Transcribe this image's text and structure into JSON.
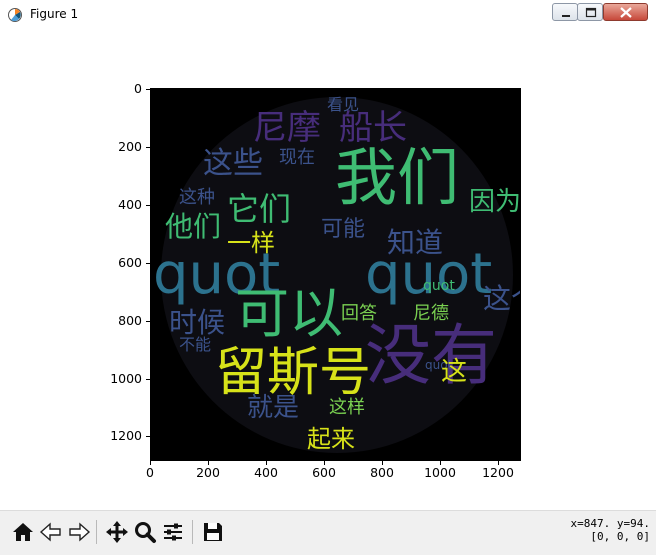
{
  "window": {
    "title": "Figure 1",
    "icon": "matplotlib-icon"
  },
  "colors": {
    "plot_bg": "#000000",
    "yellow": "#d7e219",
    "green": "#3fbc73",
    "teal": "#2c728e",
    "blue": "#3b528b",
    "purple": "#472d7b",
    "lime": "#7ad151"
  },
  "axes": {
    "x_ticks": [
      "0",
      "200",
      "400",
      "600",
      "800",
      "1000",
      "1200"
    ],
    "y_ticks": [
      "0",
      "200",
      "400",
      "600",
      "800",
      "1000",
      "1200"
    ],
    "xlim": [
      0,
      1280
    ],
    "ylim": [
      1280,
      0
    ]
  },
  "wordcloud": {
    "words": [
      {
        "text": "我们",
        "color": "#3fbc73"
      },
      {
        "text": "quot",
        "color": "#2c728e"
      },
      {
        "text": "quot",
        "color": "#2c728e"
      },
      {
        "text": "可以",
        "color": "#3fbc73"
      },
      {
        "text": "留斯号",
        "color": "#d7e219"
      },
      {
        "text": "没有",
        "color": "#472d7b"
      },
      {
        "text": "尼摩",
        "color": "#472d7b"
      },
      {
        "text": "船长",
        "color": "#472d7b"
      },
      {
        "text": "这些",
        "color": "#3b528b"
      },
      {
        "text": "它们",
        "color": "#3fbc73"
      },
      {
        "text": "他们",
        "color": "#3fbc73"
      },
      {
        "text": "一样",
        "color": "#d7e219"
      },
      {
        "text": "知道",
        "color": "#3b528b"
      },
      {
        "text": "因为",
        "color": "#3fbc73"
      },
      {
        "text": "时候",
        "color": "#3b528b"
      },
      {
        "text": "就是",
        "color": "#3b528b"
      },
      {
        "text": "起来",
        "color": "#d7e219"
      },
      {
        "text": "这个",
        "color": "#3b528b"
      },
      {
        "text": "这种",
        "color": "#3b528b"
      },
      {
        "text": "可能",
        "color": "#3b528b"
      },
      {
        "text": "现在",
        "color": "#3b528b"
      },
      {
        "text": "看见",
        "color": "#3b528b"
      },
      {
        "text": "回答",
        "color": "#7ad151"
      },
      {
        "text": "不能",
        "color": "#3b528b"
      },
      {
        "text": "这样",
        "color": "#7ad151"
      },
      {
        "text": "尼德",
        "color": "#7ad151"
      },
      {
        "text": "quot",
        "color": "#3fbc73"
      },
      {
        "text": "quot",
        "color": "#3b528b"
      },
      {
        "text": "这",
        "color": "#d7e219"
      }
    ]
  },
  "toolbar": {
    "tools": [
      "home-icon",
      "back-icon",
      "forward-icon",
      "pan-icon",
      "zoom-icon",
      "configure-icon",
      "save-icon"
    ]
  },
  "status": {
    "coords_line1": "x=847. y=94.",
    "coords_line2": "[0, 0, 0]"
  }
}
